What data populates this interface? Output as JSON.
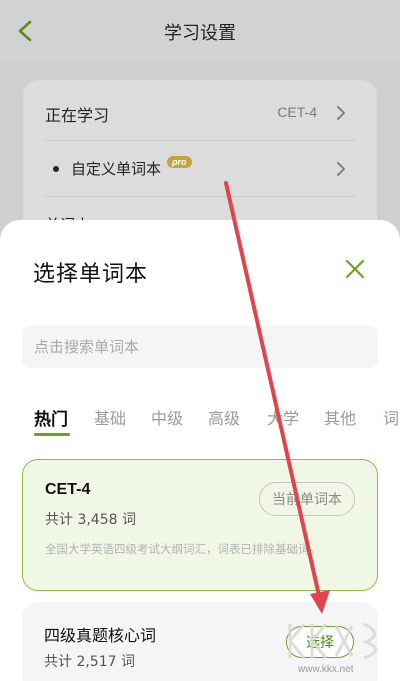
{
  "header": {
    "title": "学习设置"
  },
  "settings": {
    "learning_label": "正在学习",
    "learning_value": "CET-4",
    "custom_label": "自定义单词本",
    "custom_badge": "pro",
    "partial_row_label": "单词本"
  },
  "sheet": {
    "title": "选择单词本",
    "search_placeholder": "点击搜索单词本",
    "tabs": [
      {
        "label": "热门",
        "active": true
      },
      {
        "label": "基础"
      },
      {
        "label": "中级"
      },
      {
        "label": "高级"
      },
      {
        "label": "大学"
      },
      {
        "label": "其他"
      },
      {
        "label": "词"
      }
    ],
    "books": [
      {
        "name": "CET-4",
        "count": "共计 3,458 词",
        "description": "全国大学英语四级考试大纲词汇，词表已排除基础词。",
        "action": "当前单词本",
        "current": true
      },
      {
        "name": "四级真题核心词",
        "count": "共计 2,517 词",
        "action": "选择",
        "current": false
      }
    ]
  },
  "watermark": {
    "url": "www.kkx.net"
  },
  "colors": {
    "accent": "#6fa024",
    "annotation_arrow": "#e0454b",
    "current_card_bg": "#f1f7e6"
  }
}
